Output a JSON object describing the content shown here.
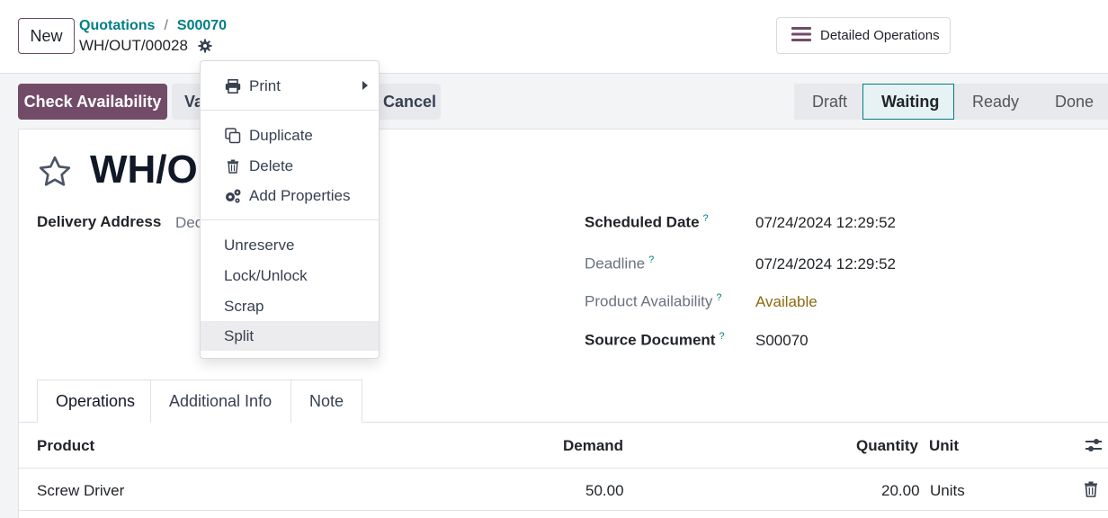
{
  "header": {
    "new_label": "New",
    "breadcrumb": [
      "Quotations",
      "S00070"
    ],
    "breadcrumb_sep": "/",
    "record_name": "WH/OUT/00028",
    "detailed_operations_label": "Detailed Operations"
  },
  "actions": {
    "check_availability": "Check Availability",
    "validate_partial": "Va",
    "cancel": "Cancel"
  },
  "statusbar": {
    "stages": [
      "Draft",
      "Waiting",
      "Ready",
      "Done"
    ],
    "current": "Waiting"
  },
  "form": {
    "title_partial": "WH/O",
    "delivery_address_label": "Delivery Address",
    "delivery_address_value_partial": "Dec",
    "scheduled_date_label": "Scheduled Date",
    "scheduled_date_value": "07/24/2024 12:29:52",
    "deadline_label": "Deadline",
    "deadline_value": "07/24/2024 12:29:52",
    "product_availability_label": "Product Availability",
    "product_availability_value": "Available",
    "source_document_label": "Source Document",
    "source_document_value": "S00070",
    "help_mark": "?"
  },
  "tabs": [
    "Operations",
    "Additional Info",
    "Note"
  ],
  "table": {
    "columns": {
      "product": "Product",
      "demand": "Demand",
      "quantity": "Quantity",
      "unit": "Unit"
    },
    "rows": [
      {
        "product": "Screw Driver",
        "demand": "50.00",
        "quantity": "20.00",
        "unit": "Units"
      }
    ]
  },
  "menu": {
    "print": "Print",
    "duplicate": "Duplicate",
    "delete": "Delete",
    "add_properties": "Add Properties",
    "unreserve": "Unreserve",
    "lock_unlock": "Lock/Unlock",
    "scrap": "Scrap",
    "split": "Split"
  },
  "colors": {
    "primary": "#714b67",
    "link": "#017e84",
    "available": "#8d6a12"
  }
}
